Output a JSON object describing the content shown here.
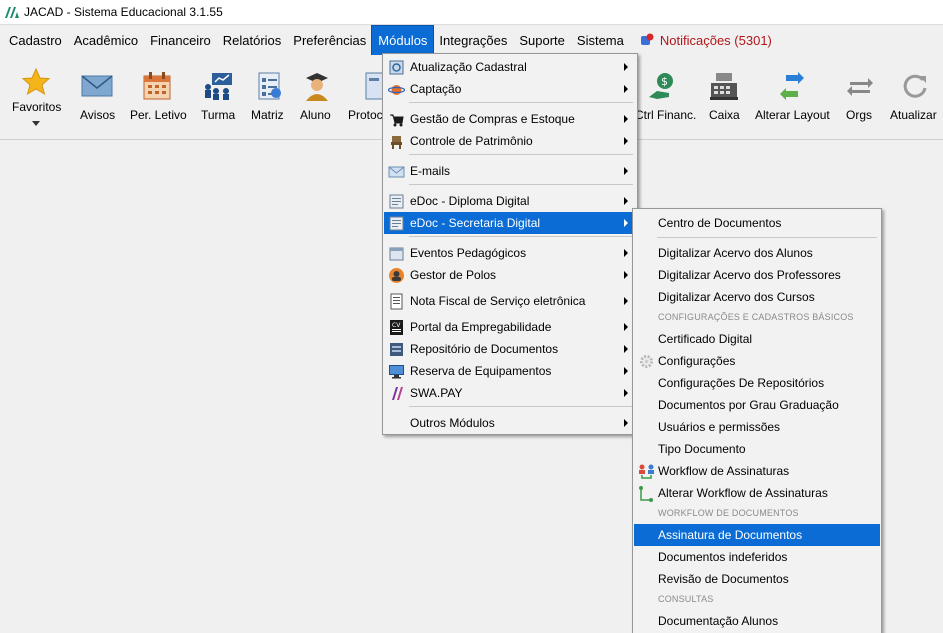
{
  "window": {
    "title": "JACAD - Sistema Educacional 3.1.55"
  },
  "menubar": {
    "items": [
      "Cadastro",
      "Acadêmico",
      "Financeiro",
      "Relatórios",
      "Preferências",
      "Módulos",
      "Integrações",
      "Suporte",
      "Sistema"
    ],
    "notifications": "Notificações (5301)"
  },
  "toolbar": {
    "items": [
      "Favoritos",
      "Avisos",
      "Per. Letivo",
      "Turma",
      "Matriz",
      "Aluno",
      "Protoc",
      "Ctrl Financ.",
      "Caixa",
      "Alterar Layout",
      "Orgs",
      "Atualizar"
    ]
  },
  "modulos_menu": {
    "items": [
      "Atualização Cadastral",
      "Captação",
      "Gestão de Compras e Estoque",
      "Controle de Patrimônio",
      "E-mails",
      "eDoc - Diploma Digital",
      "eDoc - Secretaria Digital",
      "Eventos Pedagógicos",
      "Gestor de Polos",
      "Nota Fiscal de Serviço eletrônica",
      "Portal da Empregabilidade",
      "Repositório de Documentos",
      "Reserva de Equipamentos",
      "SWA.PAY",
      "Outros Módulos"
    ]
  },
  "secretaria_submenu": {
    "items": [
      "Centro de Documentos",
      "Digitalizar Acervo dos Alunos",
      "Digitalizar Acervo dos Professores",
      "Digitalizar Acervo dos Cursos",
      "Certificado Digital",
      "Configurações",
      "Configurações De Repositórios",
      "Documentos por Grau Graduação",
      "Usuários e permissões",
      "Tipo Documento",
      "Workflow de Assinaturas",
      "Alterar Workflow de Assinaturas",
      "Assinatura de Documentos",
      "Documentos indeferidos",
      "Revisão de Documentos",
      "Documentação Alunos"
    ],
    "sections": [
      "CONFIGURAÇÕES E CADASTROS BÁSICOS",
      "WORKFLOW DE DOCUMENTOS",
      "CONSULTAS"
    ]
  },
  "colors": {
    "highlight": "#0a6cd4",
    "notification": "#b0161a"
  }
}
